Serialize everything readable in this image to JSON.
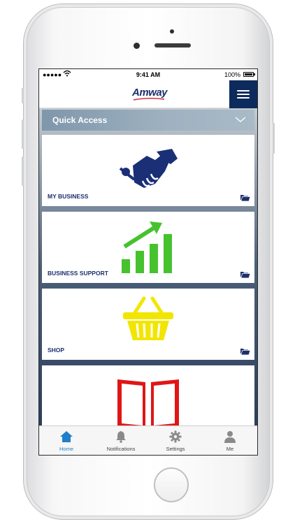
{
  "status": {
    "time": "9:41 AM",
    "battery": "100%",
    "signal": "●●●●●"
  },
  "header": {
    "logo": "Amway",
    "menu_icon": "hamburger-menu-icon"
  },
  "quick_access": {
    "label": "Quick Access",
    "icon": "chevron-down-icon"
  },
  "cards": [
    {
      "title": "MY BUSINESS",
      "icon": "handshake-icon"
    },
    {
      "title": "BUSINESS SUPPORT",
      "icon": "growth-chart-icon"
    },
    {
      "title": "SHOP",
      "icon": "shopping-basket-icon"
    },
    {
      "title": "",
      "icon": "open-book-icon"
    }
  ],
  "tabs": [
    {
      "label": "Home",
      "icon": "home-icon",
      "active": true
    },
    {
      "label": "Notifications",
      "icon": "bell-icon",
      "active": false
    },
    {
      "label": "Settings",
      "icon": "gear-icon",
      "active": false
    },
    {
      "label": "Me",
      "icon": "person-icon",
      "active": false
    }
  ],
  "colors": {
    "brand_navy": "#1d2f6b",
    "menu_bg": "#0d2a5c",
    "active_tab": "#1f7fc8",
    "chart_green": "#3fbf2a",
    "basket_yellow": "#f2e600",
    "book_red": "#e01616"
  }
}
